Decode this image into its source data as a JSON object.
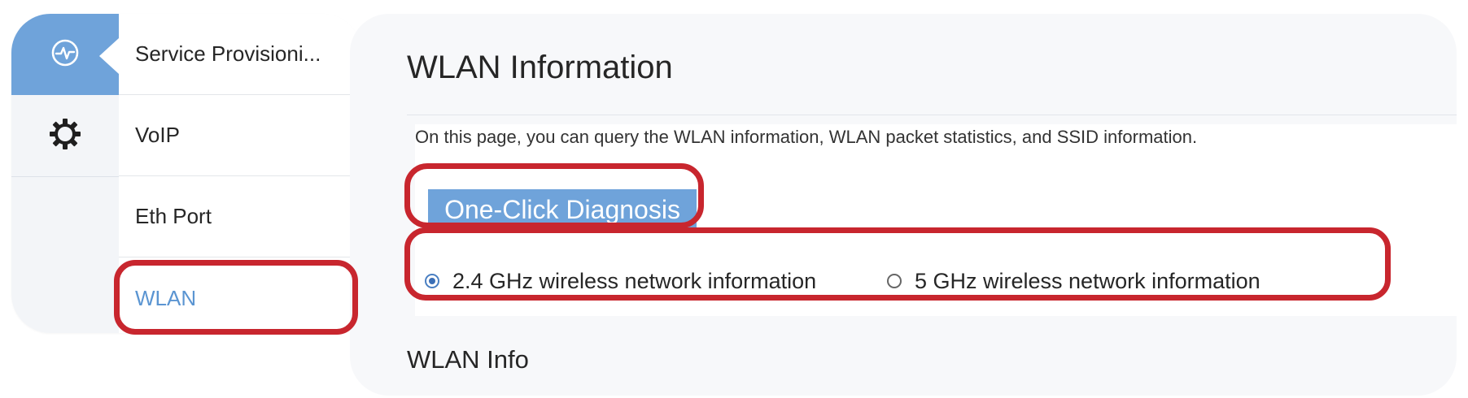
{
  "sidebar": {
    "rail": [
      {
        "icon": "status-pulse-icon",
        "active": true
      },
      {
        "icon": "gear-icon",
        "active": false
      }
    ],
    "items": [
      {
        "label": "Service Provisioni..."
      },
      {
        "label": "VoIP"
      },
      {
        "label": "Eth Port"
      },
      {
        "label": "WLAN",
        "selected": true
      }
    ]
  },
  "main": {
    "title": "WLAN Information",
    "description": "On this page, you can query the WLAN information, WLAN packet statistics, and SSID information.",
    "diagnosis_button": "One-Click Diagnosis",
    "radio_options": [
      {
        "label": "2.4 GHz wireless network information",
        "checked": true
      },
      {
        "label": "5 GHz wireless network information",
        "checked": false
      }
    ],
    "section_title": "WLAN Info"
  },
  "colors": {
    "accent": "#6fa3da",
    "selected_text": "#5b95d2",
    "highlight": "#c8262e"
  }
}
